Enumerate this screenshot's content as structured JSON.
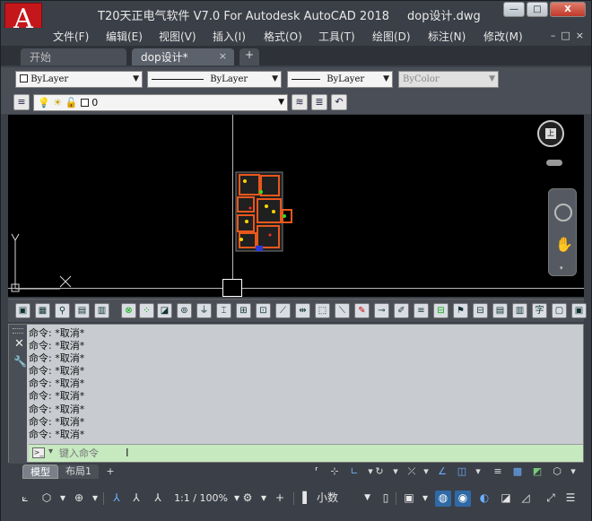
{
  "app": {
    "logo_letter": "A",
    "title": "T20天正电气软件 V7.0 For Autodesk AutoCAD 2018",
    "document": "dop设计.dwg",
    "window_buttons": [
      "—",
      "□",
      "X"
    ]
  },
  "menu": {
    "items": [
      "文件(F)",
      "编辑(E)",
      "视图(V)",
      "插入(I)",
      "格式(O)",
      "工具(T)",
      "绘图(D)",
      "标注(N)",
      "修改(M)"
    ],
    "doc_controls": [
      "–",
      "□",
      "×"
    ]
  },
  "tabs": [
    {
      "label": "开始"
    },
    {
      "label": "dop设计*"
    }
  ],
  "tab_add": "+",
  "tab_close": "×",
  "properties": {
    "color": "ByLayer",
    "linetype": "ByLayer",
    "lineweight": "ByLayer",
    "plotstyle": "ByColor"
  },
  "layer": {
    "current": "0",
    "icons": [
      "lightbulb-icon",
      "sun-icon",
      "lock-icon"
    ]
  },
  "viewcube": {
    "face": "上"
  },
  "ucs": {
    "y_label": "Y",
    "x_label": "X"
  },
  "command_history": [
    "命令: *取消*",
    "命令: *取消*",
    "命令: *取消*",
    "命令: *取消*",
    "命令: *取消*",
    "命令: *取消*",
    "命令: *取消*",
    "命令: *取消*",
    "命令: *取消*",
    "命令: *取消*"
  ],
  "command_input": {
    "placeholder": "键入命令"
  },
  "layout_tabs": [
    {
      "label": "模型"
    },
    {
      "label": "布局1"
    }
  ],
  "layout_add": "+",
  "status": {
    "scale": "1:1 / 100%",
    "units": "小数"
  },
  "colors": {
    "titlebar": "#3b3f47",
    "canvas": "#000000",
    "command_input_bg": "#c6e9c0",
    "logo": "#c4171b",
    "status_active": "#2f6aa6"
  }
}
